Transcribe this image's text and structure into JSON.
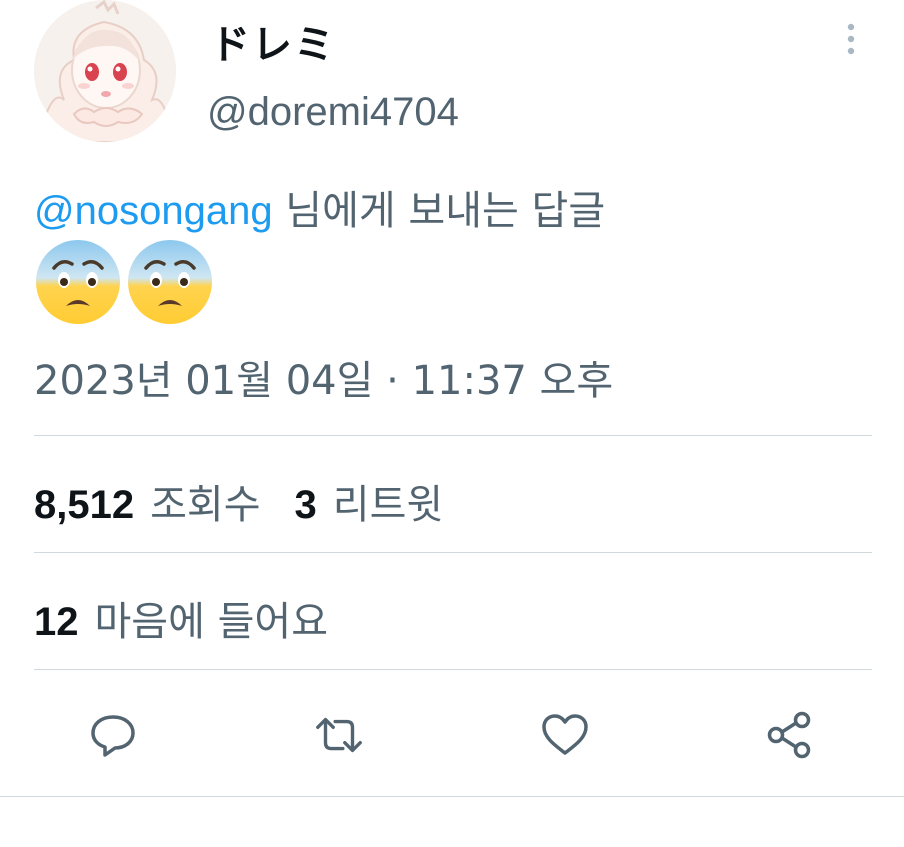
{
  "author": {
    "display_name": "ドレミ",
    "handle": "@doremi4704",
    "avatar_icon": "anime-avatar-icon"
  },
  "reply_context": {
    "mention": "@nosongang",
    "suffix": " 님에게 보내는 답글"
  },
  "content": {
    "emojis": [
      "anxious-face-icon",
      "anxious-face-icon"
    ]
  },
  "timestamp": "2023년 01월 04일 · 11:37 오후",
  "stats": {
    "views_count": "8,512",
    "views_label": "조회수",
    "retweets_count": "3",
    "retweets_label": "리트윗",
    "likes_count": "12",
    "likes_label": "마음에 들어요"
  },
  "actions": [
    "reply-icon",
    "retweet-icon",
    "like-icon",
    "share-icon"
  ],
  "colors": {
    "link": "#1d9bf0",
    "secondary_text": "#536471",
    "primary_text": "#0f1419",
    "divider": "#cfd9de"
  }
}
